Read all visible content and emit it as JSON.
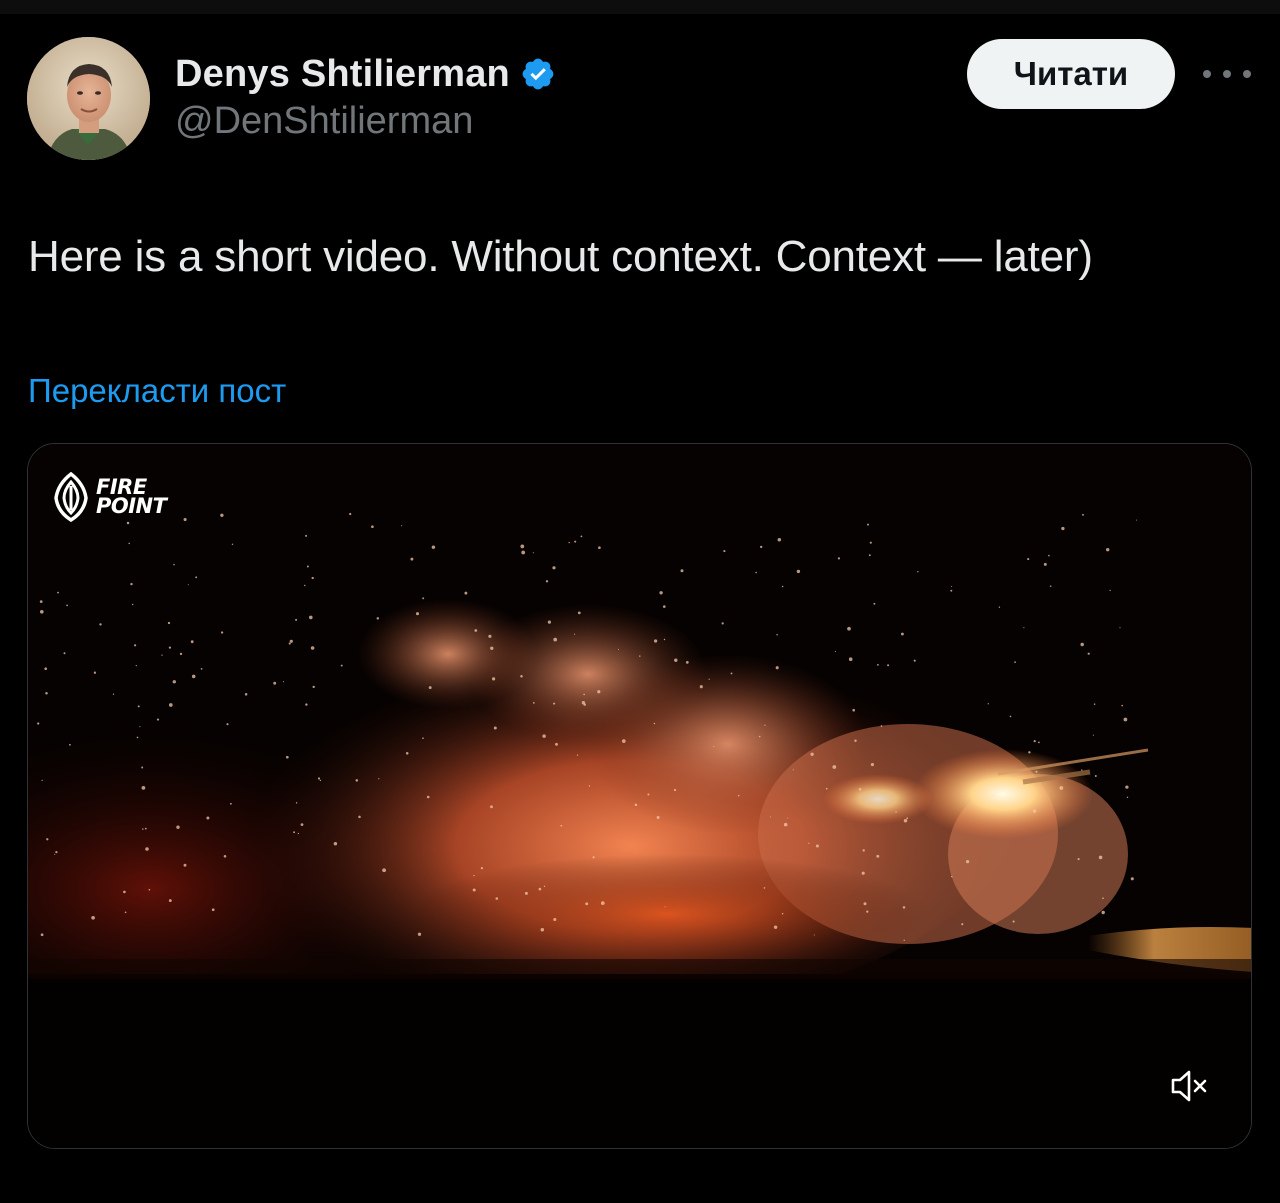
{
  "author": {
    "display_name": "Denys Shtilierman",
    "handle": "@DenShtilierman",
    "verified": true,
    "avatar_icon": "user-avatar-photo"
  },
  "actions": {
    "follow_label": "Читати",
    "more_icon": "more-horizontal-icon"
  },
  "post": {
    "text": "Here is a short video. Without context. Context — later)",
    "translate_label": "Перекласти пост"
  },
  "media": {
    "type": "video",
    "watermark_lines": [
      "FIRE",
      "POINT"
    ],
    "mute_icon": "volume-muted-icon",
    "muted": true
  },
  "colors": {
    "background": "#000000",
    "text_primary": "#e7e9ea",
    "text_secondary": "#71767b",
    "link": "#1d9bf0",
    "verified_badge": "#1d9bf0",
    "follow_button_bg": "#eff3f4"
  }
}
